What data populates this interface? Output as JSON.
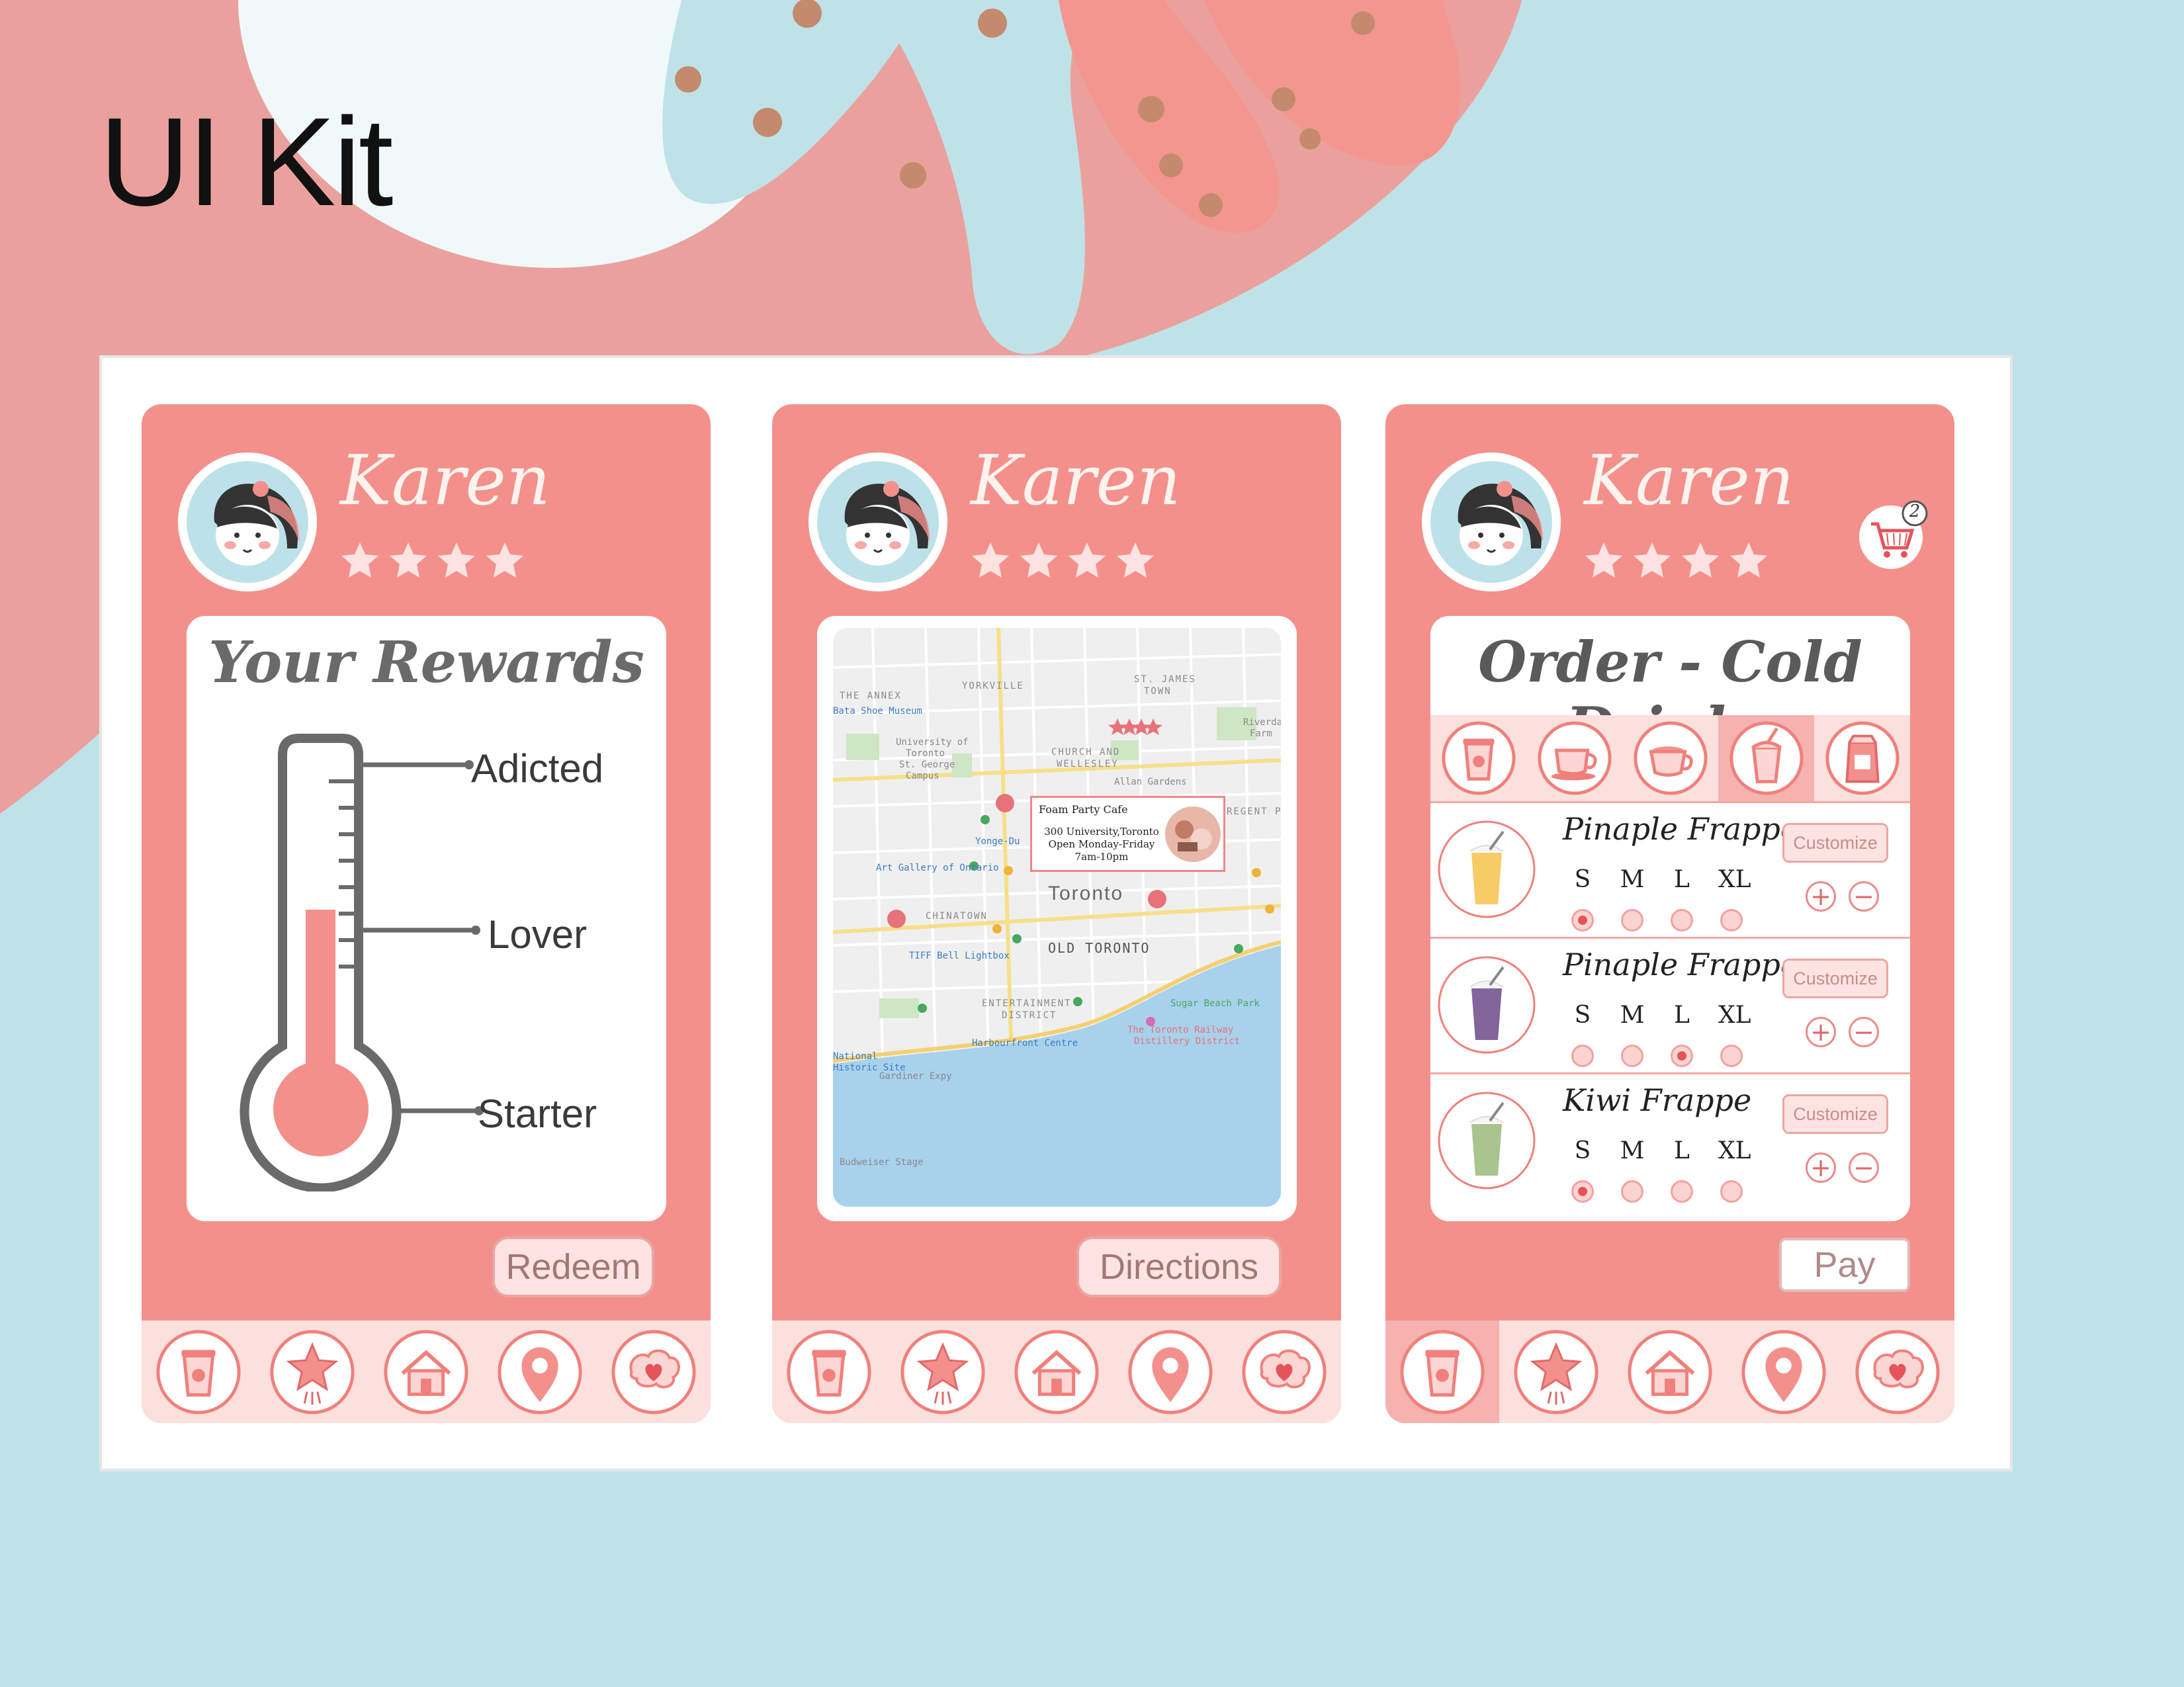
{
  "kit": {
    "title": "UI Kit"
  },
  "user": {
    "name": "Karen",
    "rating": 4
  },
  "rewards": {
    "title": "Your Rewards",
    "levels": [
      "Adicted",
      "Lover",
      "Starter"
    ],
    "fill_fraction": 0.55,
    "redeem_label": "Redeem"
  },
  "map": {
    "labels": [
      "THE ANNEX",
      "YORKVILLE",
      "ST. JAMES",
      "TOWN",
      "CHURCH AND",
      "WELLESLEY",
      "Allan Gardens",
      "Toronto",
      "CHINATOWN",
      "OLD TORONTO",
      "ENTERTAINMENT",
      "DISTRICT",
      "Sugar Beach Park",
      "Harbourfront Centre",
      "TIFF Bell Lightbox",
      "Art Gallery of Ontario",
      "University of",
      "Toronto",
      "St. George",
      "Campus",
      "Yonge-Du",
      "Bata Shoe Museum",
      "Gardiner Expy",
      "Riverdale",
      "Farm",
      "REGENT P",
      "National",
      "Historic Site",
      "Budweiser Stage",
      "The Toronto Railway",
      "Distillery District"
    ],
    "popup": {
      "name": "Foam Party Cafe",
      "address": "300 University,Toronto",
      "hours": "Open Monday-Friday",
      "time": "7am-10pm"
    },
    "directions_label": "Directions"
  },
  "order": {
    "title": "Order - Cold Drinks",
    "cart_count": "2",
    "categories": [
      "coffee-cup-icon",
      "espresso-icon",
      "cappuccino-icon",
      "cold-drink-icon",
      "coffee-bag-icon"
    ],
    "active_category": 3,
    "sizes": [
      "S",
      "M",
      "L",
      "XL"
    ],
    "customize_label": "Customize",
    "items": [
      {
        "name": "Pinaple Frappe",
        "selected_size": 0,
        "color": "#f6c24a"
      },
      {
        "name": "Pinaple Frappe",
        "selected_size": 2,
        "color": "#6b4a8a"
      },
      {
        "name": "Kiwi Frappe",
        "selected_size": 0,
        "color": "#9aba7a"
      }
    ],
    "pay_label": "Pay"
  },
  "nav": {
    "items": [
      "coffee-cup-icon",
      "rewards-star-icon",
      "home-icon",
      "location-pin-icon",
      "favorites-heart-icon"
    ],
    "active": [
      1,
      3,
      0
    ]
  },
  "colors": {
    "primary": "#f4908b",
    "light": "#fce0de",
    "accent": "#e4545a",
    "teal": "#bfe2e8"
  }
}
